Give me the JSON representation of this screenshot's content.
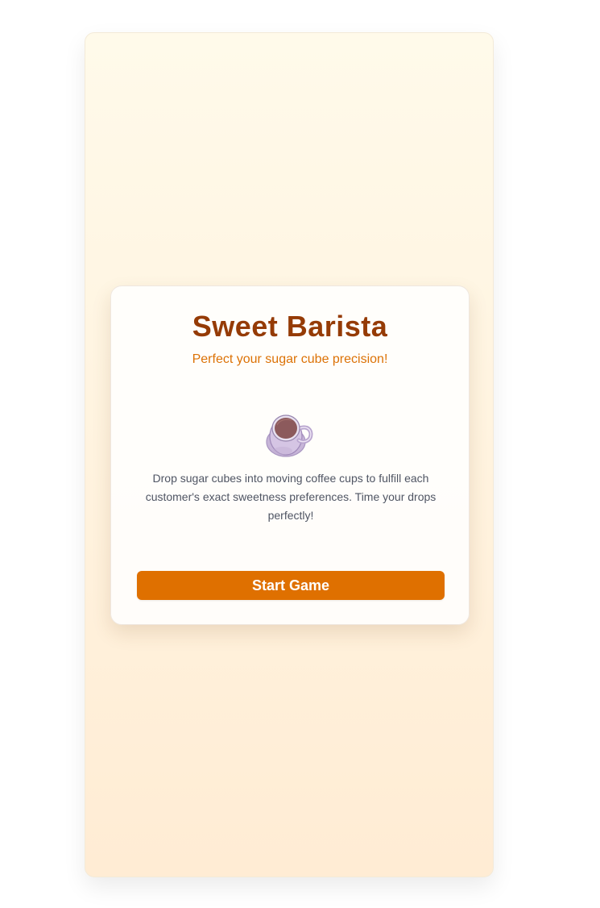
{
  "start_screen": {
    "title": "Sweet Barista",
    "subtitle": "Perfect your sugar cube precision!",
    "description": "Drop sugar cubes into moving coffee cups to fulfill each customer's exact sweetness preferences. Time your drops perfectly!",
    "start_button_label": "Start Game",
    "icon": "coffee-cup-icon"
  },
  "colors": {
    "background_top": "#fffaea",
    "background_bottom": "#ffecd4",
    "title": "#953b06",
    "subtitle": "#dc7206",
    "button": "#df7000",
    "description": "#4f5563",
    "cup": "#c8b3d8",
    "coffee": "#8c5c5e"
  }
}
